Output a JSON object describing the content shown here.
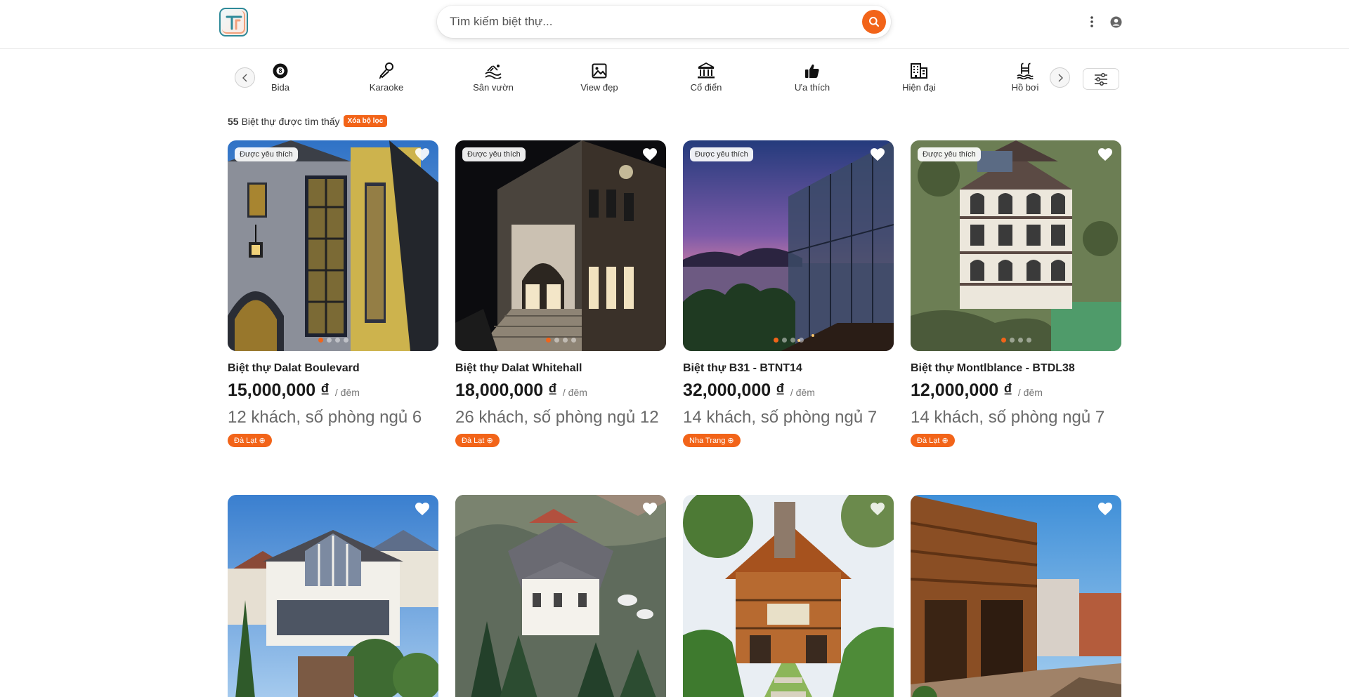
{
  "search": {
    "placeholder": "Tìm kiếm biệt thự..."
  },
  "categories": [
    {
      "label": "Bida",
      "icon": "billiard-ball-icon"
    },
    {
      "label": "Karaoke",
      "icon": "microphone-icon"
    },
    {
      "label": "Sân vườn",
      "icon": "garden-icon"
    },
    {
      "label": "View đẹp",
      "icon": "image-icon"
    },
    {
      "label": "Cổ điển",
      "icon": "classical-building-icon"
    },
    {
      "label": "Ưa thích",
      "icon": "thumbs-up-icon"
    },
    {
      "label": "Hiện đại",
      "icon": "modern-building-icon"
    },
    {
      "label": "Hồ bơi",
      "icon": "swimming-pool-icon"
    }
  ],
  "results": {
    "count": "55",
    "text": "Biệt thự được tìm thấy",
    "clear_label": "Xóa bộ lọc"
  },
  "favorite_badge": "Được yêu thích",
  "listings": [
    {
      "title": "Biệt thự Dalat Boulevard",
      "price": "15,000,000 ₫",
      "unit": "/ đêm",
      "info": "12 khách, số phòng ngủ 6",
      "location": "Đà Lạt ⊕"
    },
    {
      "title": "Biệt thự Dalat Whitehall",
      "price": "18,000,000 ₫",
      "unit": "/ đêm",
      "info": "26 khách, số phòng ngủ 12",
      "location": "Đà Lạt ⊕"
    },
    {
      "title": "Biệt thự B31 - BTNT14",
      "price": "32,000,000 ₫",
      "unit": "/ đêm",
      "info": "14 khách, số phòng ngủ 7",
      "location": "Nha Trang ⊕"
    },
    {
      "title": "Biệt thự Montlblance - BTDL38",
      "price": "12,000,000 ₫",
      "unit": "/ đêm",
      "info": "14 khách, số phòng ngủ 7",
      "location": "Đà Lạt ⊕"
    }
  ],
  "colors": {
    "accent": "#f26419",
    "logo_teal": "#2f8a99",
    "logo_peach": "#f2a07c"
  }
}
